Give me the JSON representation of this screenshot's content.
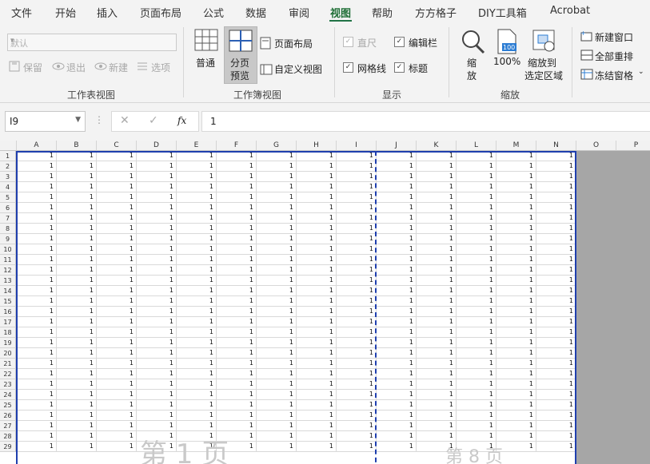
{
  "menu": {
    "tabs": [
      "文件",
      "开始",
      "插入",
      "页面布局",
      "公式",
      "数据",
      "审阅",
      "视图",
      "帮助",
      "方方格子",
      "DIY工具箱",
      "Acrobat"
    ],
    "active": "视图"
  },
  "ribbon": {
    "sheet_view": {
      "combo_value": "默认",
      "keep": "保留",
      "exit": "退出",
      "new": "新建",
      "options": "选项",
      "label": "工作表视图"
    },
    "workbook_views": {
      "normal": "普通",
      "page_break_1": "分页",
      "page_break_2": "预览",
      "page_layout": "页面布局",
      "custom_views": "自定义视图",
      "label": "工作簿视图"
    },
    "show": {
      "ruler": "直尺",
      "formula_bar": "编辑栏",
      "gridlines": "网格线",
      "headings": "标题",
      "label": "显示"
    },
    "zoom": {
      "zoom": "缩",
      "zoom2": "放",
      "hundred": "100%",
      "zoom_sel_1": "缩放到",
      "zoom_sel_2": "选定区域",
      "label": "缩放"
    },
    "window": {
      "new_window": "新建窗口",
      "arrange_all": "全部重排",
      "freeze": "冻结窗格"
    }
  },
  "formula_bar": {
    "name_box": "I9",
    "fx": "fx",
    "value": "1"
  },
  "sheet": {
    "columns": [
      "A",
      "B",
      "C",
      "D",
      "E",
      "F",
      "G",
      "H",
      "I",
      "J",
      "K",
      "L",
      "M",
      "N",
      "O",
      "P"
    ],
    "rows": [
      "1",
      "2",
      "3",
      "4",
      "5",
      "6",
      "7",
      "8",
      "9",
      "10",
      "11",
      "12",
      "13",
      "14",
      "15",
      "16",
      "17",
      "18",
      "19",
      "20",
      "21",
      "22",
      "23",
      "24",
      "25",
      "26",
      "27",
      "28",
      "29"
    ],
    "cell_value": "1",
    "watermark_1": "第 1 页",
    "watermark_2": "第 8 页"
  }
}
